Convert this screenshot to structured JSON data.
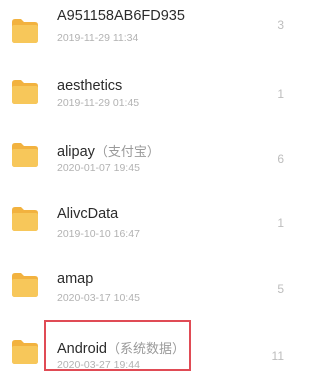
{
  "folders": [
    {
      "name": "A951158AB6FD935",
      "tag": "",
      "date": "2019-11-29 11:34",
      "count": "3"
    },
    {
      "name": "aesthetics",
      "tag": "",
      "date": "2019-11-29 01:45",
      "count": "1"
    },
    {
      "name": "alipay",
      "tag": "（支付宝）",
      "date": "2020-01-07 19:45",
      "count": "6"
    },
    {
      "name": "AlivcData",
      "tag": "",
      "date": "2019-10-10 16:47",
      "count": "1"
    },
    {
      "name": "amap",
      "tag": "",
      "date": "2020-03-17 10:45",
      "count": "5"
    },
    {
      "name": "Android",
      "tag": "（系统数据）",
      "date": "2020-03-27 19:44",
      "count": "11"
    }
  ],
  "colors": {
    "folder": "#f7c75a",
    "folder_tab": "#f2b23f",
    "highlight": "#e04b55"
  },
  "icon": "folder-icon"
}
